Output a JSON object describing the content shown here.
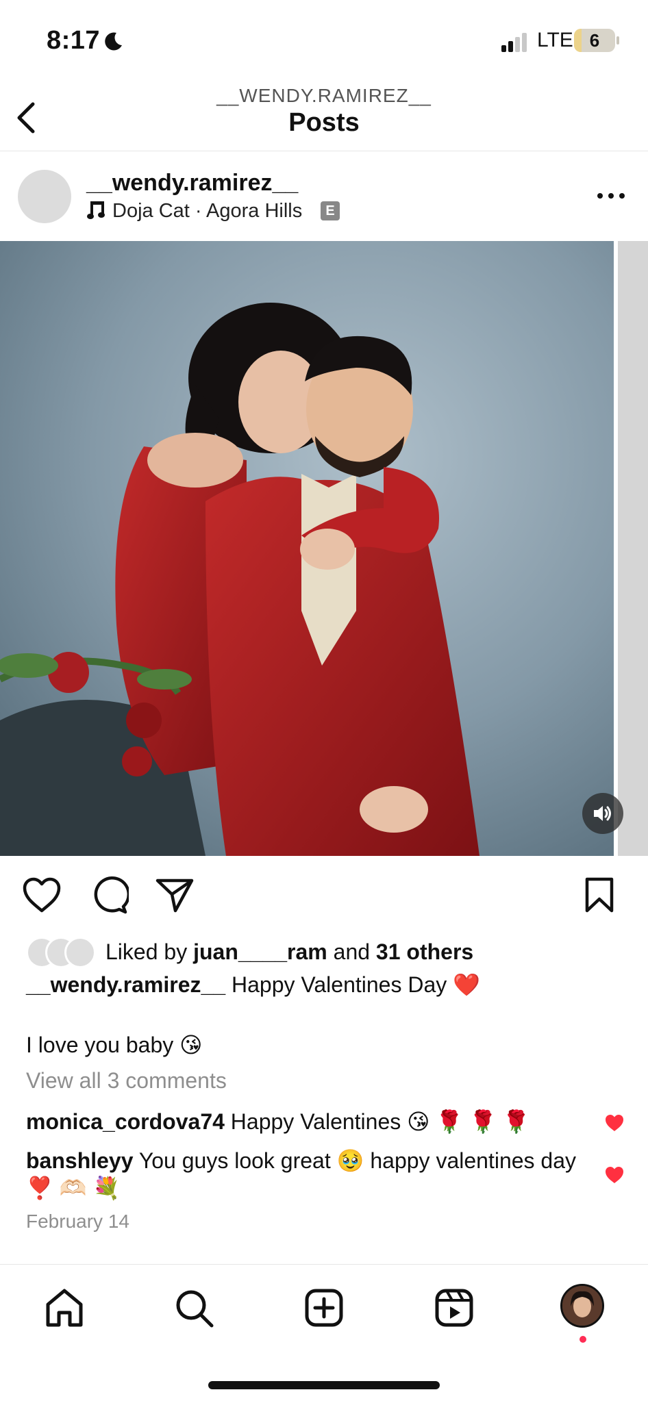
{
  "status_bar": {
    "time": "8:17",
    "network": "LTE",
    "battery": "6",
    "battery_percent": 6
  },
  "header": {
    "username": "__WENDY.RAMIREZ__",
    "title": "Posts"
  },
  "post": {
    "username": "__wendy.ramirez__",
    "music": "Doja Cat · Agora Hills",
    "explicit_badge": "E",
    "media_description_icon": "photo",
    "likes": {
      "prefix": "Liked by ",
      "user": "juan____ram",
      "middle": " and ",
      "others": "31 others"
    },
    "caption": {
      "username": "__wendy.ramirez__",
      "text": " Happy Valentines Day ❤️",
      "line2": "I love you baby 😘"
    },
    "view_comments": "View all 3 comments",
    "comments": [
      {
        "user": "monica_cordova74",
        "text": " Happy Valentines 😘 🌹 🌹 🌹"
      },
      {
        "user": "banshleyy",
        "text": " You guys look great 🥹 happy valentines day ❣️ 🫶🏻 💐"
      }
    ],
    "date": "February 14"
  },
  "colors": {
    "like_red": "#ff3040",
    "muted_text": "#8e8e8e",
    "notification": "#ff2d55"
  },
  "tabs": [
    "home",
    "search",
    "create",
    "reels",
    "profile"
  ]
}
